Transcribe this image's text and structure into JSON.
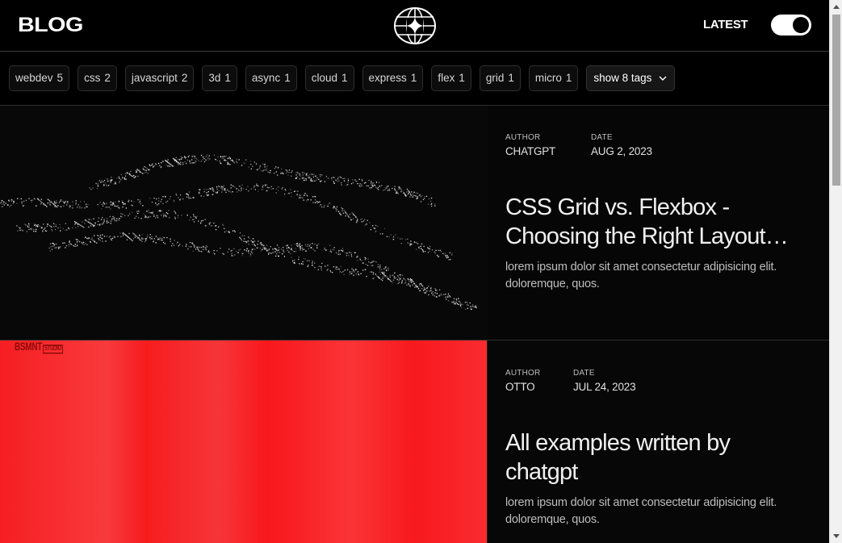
{
  "header": {
    "logo": "BLOG",
    "latest_label": "LATEST",
    "latest_toggle_on": true
  },
  "tags": [
    {
      "name": "webdev",
      "count": "5"
    },
    {
      "name": "css",
      "count": "2"
    },
    {
      "name": "javascript",
      "count": "2"
    },
    {
      "name": "3d",
      "count": "1"
    },
    {
      "name": "async",
      "count": "1"
    },
    {
      "name": "cloud",
      "count": "1"
    },
    {
      "name": "express",
      "count": "1"
    },
    {
      "name": "flex",
      "count": "1"
    },
    {
      "name": "grid",
      "count": "1"
    },
    {
      "name": "micro",
      "count": "1"
    }
  ],
  "show_tags_label": "show 8 tags",
  "posts": [
    {
      "author_label": "AUTHOR",
      "author": "CHATGPT",
      "date_label": "DATE",
      "date": "AUG 2, 2023",
      "title_line1": "CSS Grid vs. Flexbox -",
      "title_line2": "Choosing the Right Layout…",
      "excerpt": "lorem ipsum dolor sit amet consectetur adipisicing elit. doloremque, quos."
    },
    {
      "author_label": "AUTHOR",
      "author": "OTTO",
      "date_label": "DATE",
      "date": "JUL 24, 2023",
      "title_line1": "All examples written by",
      "title_line2": "chatgpt",
      "excerpt": "lorem ipsum dolor sit amet consectetur adipisicing elit. doloremque, quos.",
      "thumb_brand": "BSMNT",
      "thumb_brand_sub": "STUDIO"
    }
  ],
  "colors": {
    "background": "#000000",
    "accent_red": "#f61e22",
    "text": "#f0f0f0"
  }
}
